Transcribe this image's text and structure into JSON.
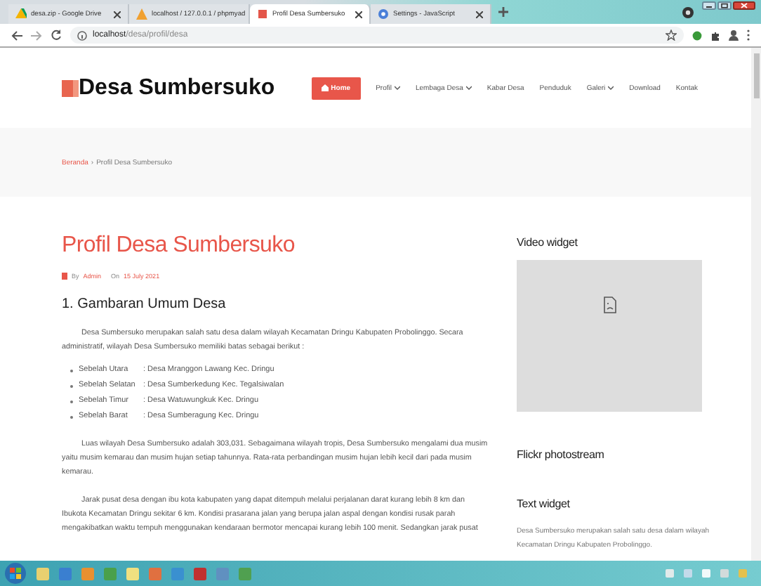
{
  "browser": {
    "tabs": [
      {
        "title": "desa.zip - Google Drive",
        "selected": false
      },
      {
        "title": "localhost / 127.0.0.1 / phpmyad",
        "selected": false
      },
      {
        "title": "Profil Desa Sumbersuko",
        "selected": true
      },
      {
        "title": "Settings - JavaScript",
        "selected": false
      }
    ],
    "address": {
      "host": "localhost",
      "path": "/desa/profil/desa"
    }
  },
  "site": {
    "logo": "Desa Sumbersuko",
    "nav": [
      {
        "label": "Home",
        "selected": true,
        "dropdown": false
      },
      {
        "label": "Profil",
        "selected": false,
        "dropdown": true
      },
      {
        "label": "Lembaga Desa",
        "selected": false,
        "dropdown": true
      },
      {
        "label": "Kabar Desa",
        "selected": false,
        "dropdown": false
      },
      {
        "label": "Penduduk",
        "selected": false,
        "dropdown": false
      },
      {
        "label": "Galeri",
        "selected": false,
        "dropdown": true
      },
      {
        "label": "Download",
        "selected": false,
        "dropdown": false
      },
      {
        "label": "Kontak",
        "selected": false,
        "dropdown": false
      }
    ],
    "breadcrumb": {
      "link": "Beranda",
      "separator": "›",
      "current": "Profil Desa Sumbersuko"
    }
  },
  "article": {
    "title": "Profil Desa Sumbersuko",
    "meta": {
      "by": "By",
      "author": "Admin",
      "on": "On",
      "date": "15 July 2021"
    },
    "heading": "1. Gambaran Umum Desa",
    "intro": "Desa Sumbersuko merupakan salah satu desa dalam wilayah Kecamatan Dringu Kabupaten Probolinggo. Secara administratif, wilayah Desa Sumbersuko memiliki batas sebagai berikut :",
    "borders": [
      {
        "label": "Sebelah Utara",
        "value": ": Desa Mranggon Lawang Kec. Dringu"
      },
      {
        "label": "Sebelah Selatan",
        "value": ": Desa Sumberkedung Kec. Tegalsiwalan"
      },
      {
        "label": "Sebelah Timur",
        "value": ": Desa Watuwungkuk Kec. Dringu"
      },
      {
        "label": "Sebelah Barat",
        "value": ": Desa Sumberagung Kec. Dringu"
      }
    ],
    "paragraphs": [
      "Luas wilayah Desa Sumbersuko adalah 303,031. Sebagaimana wilayah tropis, Desa Sumbersuko mengalami dua musim yaitu musim kemarau dan musim hujan setiap tahunnya. Rata-rata perbandingan musim hujan lebih kecil dari pada musim kemarau.",
      "Jarak pusat desa dengan ibu kota kabupaten yang dapat ditempuh melalui perjalanan darat kurang lebih 8 km dan Ibukota Kecamatan Dringu sekitar 6 km. Kondisi prasarana jalan yang berupa jalan aspal dengan kondisi rusak parah mengakibatkan waktu tempuh menggunakan kendaraan bermotor mencapai kurang lebih 100 menit. Sedangkan jarak pusat"
    ]
  },
  "sidebar": [
    {
      "kind": "video",
      "title": "Video widget"
    },
    {
      "kind": "plain",
      "title": "Flickr photostream"
    },
    {
      "kind": "text",
      "title": "Text widget",
      "text": "Desa Sumbersuko merupakan salah satu desa dalam wilayah Kecamatan Dringu Kabupaten Probolinggo."
    }
  ]
}
